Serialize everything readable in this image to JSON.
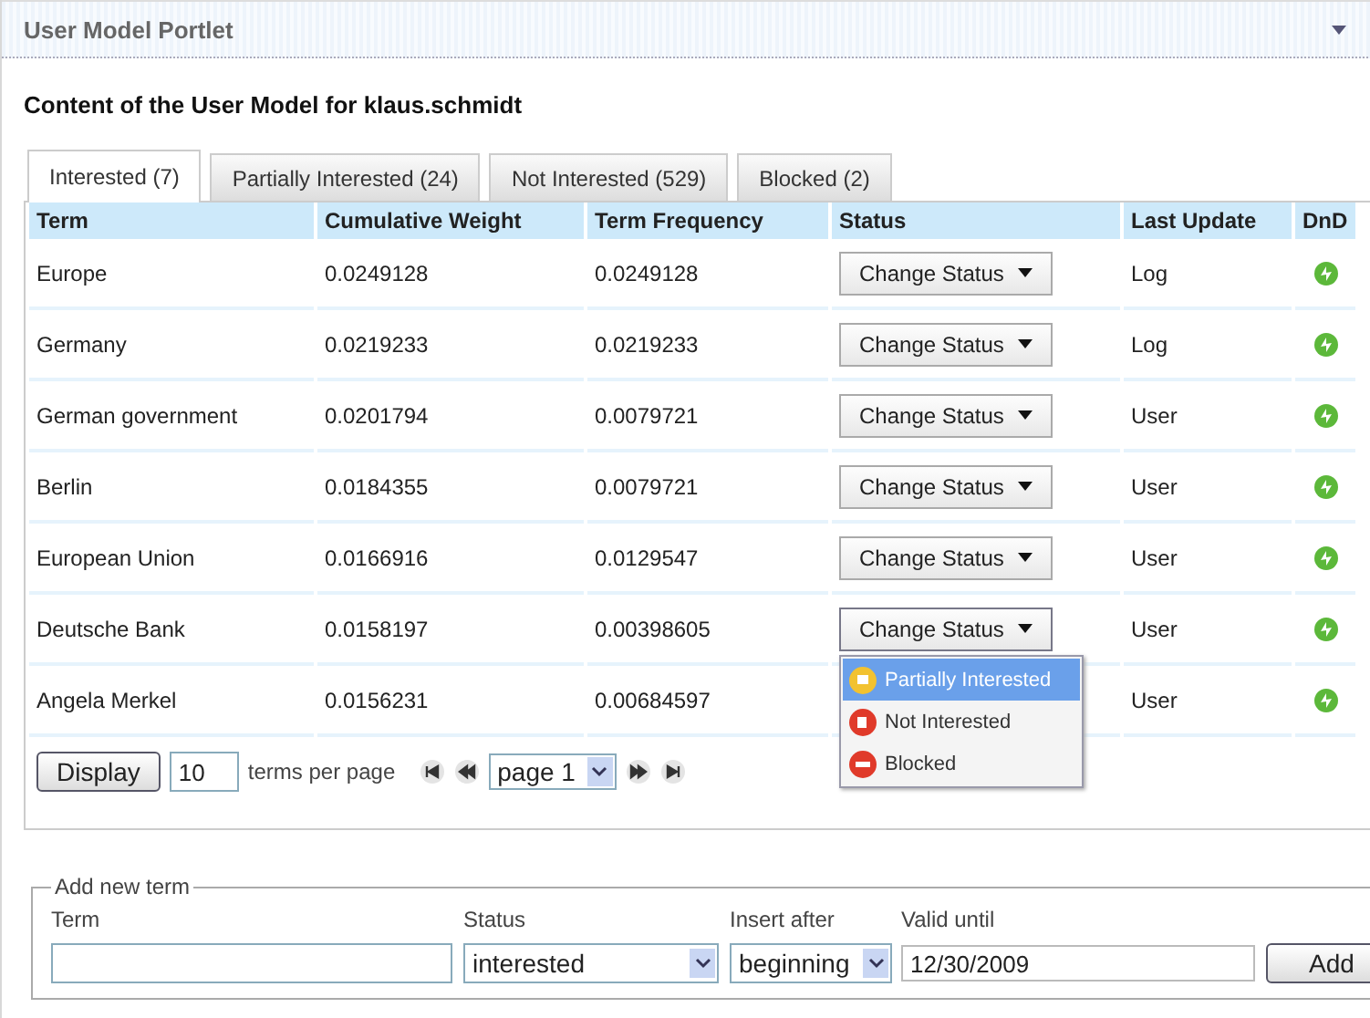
{
  "portlet": {
    "title": "User Model Portlet"
  },
  "heading": "Content of the User Model for klaus.schmidt",
  "tabs": [
    {
      "label": "Interested (7)",
      "selected": true
    },
    {
      "label": "Partially Interested (24)",
      "selected": false
    },
    {
      "label": "Not Interested (529)",
      "selected": false
    },
    {
      "label": "Blocked (2)",
      "selected": false
    }
  ],
  "table": {
    "columns": [
      "Term",
      "Cumulative Weight",
      "Term Frequency",
      "Status",
      "Last Update",
      "DnD"
    ],
    "rows": [
      {
        "term": "Europe",
        "cumulative_weight": "0.0249128",
        "term_frequency": "0.0249128",
        "status_button": "Change Status",
        "last_update": "Log",
        "menu_open": false
      },
      {
        "term": "Germany",
        "cumulative_weight": "0.0219233",
        "term_frequency": "0.0219233",
        "status_button": "Change Status",
        "last_update": "Log",
        "menu_open": false
      },
      {
        "term": "German government",
        "cumulative_weight": "0.0201794",
        "term_frequency": "0.0079721",
        "status_button": "Change Status",
        "last_update": "User",
        "menu_open": false
      },
      {
        "term": "Berlin",
        "cumulative_weight": "0.0184355",
        "term_frequency": "0.0079721",
        "status_button": "Change Status",
        "last_update": "User",
        "menu_open": false
      },
      {
        "term": "European Union",
        "cumulative_weight": "0.0166916",
        "term_frequency": "0.0129547",
        "status_button": "Change Status",
        "last_update": "User",
        "menu_open": false
      },
      {
        "term": "Deutsche Bank",
        "cumulative_weight": "0.0158197",
        "term_frequency": "0.00398605",
        "status_button": "Change Status",
        "last_update": "User",
        "menu_open": true
      },
      {
        "term": "Angela Merkel",
        "cumulative_weight": "0.0156231",
        "term_frequency": "0.00684597",
        "last_update": "User",
        "menu_open": false
      }
    ]
  },
  "status_menu": [
    {
      "label": "Partially Interested",
      "kind": "partial",
      "selected": true
    },
    {
      "label": "Not Interested",
      "kind": "not",
      "selected": false
    },
    {
      "label": "Blocked",
      "kind": "blocked",
      "selected": false
    }
  ],
  "pager": {
    "display_button": "Display",
    "per_page": "10",
    "per_page_label": "terms per page",
    "page": "page 1"
  },
  "add_term": {
    "legend": "Add new term",
    "term_label": "Term",
    "status_label": "Status",
    "status_value": "interested",
    "insert_label": "Insert after",
    "insert_value": "beginning",
    "valid_label": "Valid until",
    "valid_value": "12/30/2009",
    "add_button": "Add"
  }
}
